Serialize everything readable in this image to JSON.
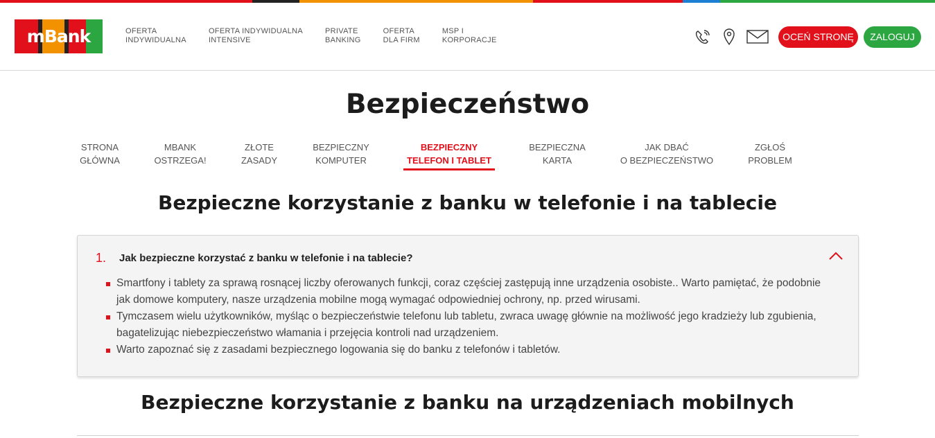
{
  "brand": {
    "logo_text": "mBank",
    "stripe_colors": [
      "#e1101a",
      "#222222",
      "#f39200",
      "#e1101a",
      "#1b7fd3",
      "#2ba640"
    ],
    "logo_colors": [
      "#e1101a",
      "#222222",
      "#f39200",
      "#e1101a",
      "#2ba640"
    ],
    "accent": "#e1101a",
    "green": "#2ba640"
  },
  "topnav": {
    "items": [
      {
        "label": "OFERTA\nINDYWIDUALNA"
      },
      {
        "label": "OFERTA INDYWIDUALNA\nINTENSIVE"
      },
      {
        "label": "PRIVATE\nBANKING"
      },
      {
        "label": "OFERTA\nDLA FIRM"
      },
      {
        "label": "MSP I\nKORPORACJE"
      }
    ]
  },
  "header_icons": [
    "phone-icon",
    "location-pin-icon",
    "envelope-icon"
  ],
  "buttons": {
    "rate": "OCEŃ STRONĘ",
    "login": "ZALOGUJ"
  },
  "page_title": "Bezpieczeństwo",
  "subnav": {
    "items": [
      {
        "label": "STRONA\nGŁÓWNA"
      },
      {
        "label": "MBANK\nOSTRZEGA!"
      },
      {
        "label": "ZŁOTE\nZASADY"
      },
      {
        "label": "BEZPIECZNY\nKOMPUTER"
      },
      {
        "label": "BEZPIECZNY\nTELEFON I TABLET",
        "active": true
      },
      {
        "label": "BEZPIECZNA\nKARTA"
      },
      {
        "label": "JAK DBAĆ\nO BEZPIECZEŃSTWO"
      },
      {
        "label": "ZGŁOŚ\nPROBLEM"
      }
    ]
  },
  "section1": {
    "heading": "Bezpieczne korzystanie z banku w telefonie i na tablecie",
    "accordion": {
      "number": "1.",
      "question": "Jak bezpieczne korzystać z banku w telefonie i na tablecie?",
      "expanded": true,
      "bullets": [
        {
          "line1": "Smartfony i tablety za sprawą rosnącej liczby oferowanych funkcji, coraz częściej zastępują inne urządzenia osobiste.. Warto pamiętać, że podobnie",
          "line2": "jak domowe komputery, nasze urządzenia mobilne mogą wymagać odpowiedniej ochrony, np. przed wirusami."
        },
        {
          "line1": "Tymczasem wielu użytkowników, myśląc o bezpieczeństwie telefonu lub tabletu, zwraca uwagę głównie na możliwość jego kradzieży lub zgubienia,",
          "line2": "bagatelizując niebezpieczeństwo włamania i przejęcia kontroli nad urządzeniem."
        },
        {
          "line1": "Warto zapoznać się z zasadami bezpiecznego logowania się do banku z telefonów i tabletów.",
          "line2": ""
        }
      ]
    }
  },
  "section2": {
    "heading": "Bezpieczne korzystanie z banku na urządzeniach mobilnych"
  }
}
